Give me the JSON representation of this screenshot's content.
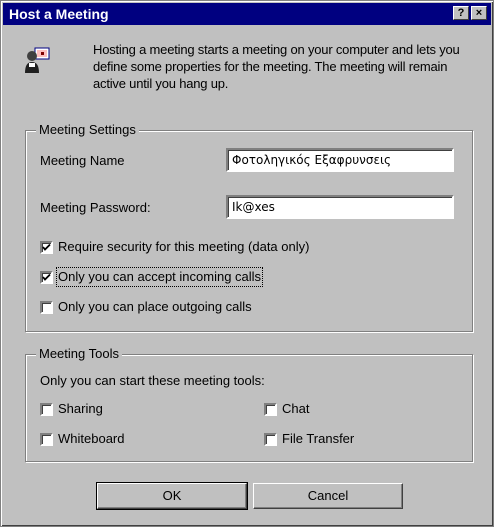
{
  "window": {
    "title": "Host a Meeting",
    "help_label": "?",
    "close_label": "×"
  },
  "intro": {
    "icon": "host-meeting-icon",
    "text": "Hosting a meeting starts a meeting on your computer and lets you define some properties for the meeting. The meeting will remain active until you hang up."
  },
  "settings": {
    "legend": "Meeting Settings",
    "name_label": "Meeting Name",
    "name_value": "Φοτοληγικός Εξαφρυνσεις",
    "password_label": "Meeting Password:",
    "password_value": "Ik@xes",
    "options": [
      {
        "label": "Require security for this meeting (data only)",
        "checked": true
      },
      {
        "label": "Only you can accept incoming calls",
        "checked": true
      },
      {
        "label": "Only you can place outgoing calls",
        "checked": false
      }
    ]
  },
  "tools": {
    "legend": "Meeting Tools",
    "intro": "Only you can start these meeting tools:",
    "items": [
      {
        "label": "Sharing",
        "checked": false
      },
      {
        "label": "Chat",
        "checked": false
      },
      {
        "label": "Whiteboard",
        "checked": false
      },
      {
        "label": "File Transfer",
        "checked": false
      }
    ]
  },
  "buttons": {
    "ok": "OK",
    "cancel": "Cancel"
  },
  "colors": {
    "titlebar": "#000080",
    "face": "#c0c0c0"
  }
}
